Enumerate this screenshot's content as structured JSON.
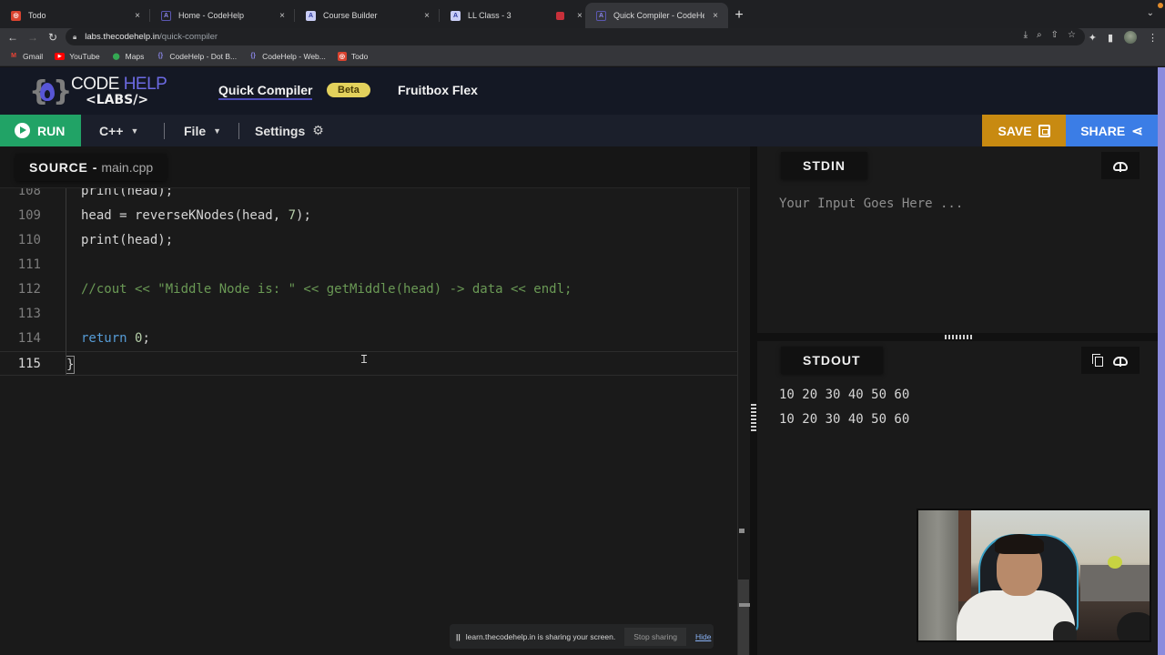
{
  "browser": {
    "tabs": [
      {
        "title": "Todo",
        "favicon": "todo-icon",
        "active": false
      },
      {
        "title": "Home - CodeHelp",
        "favicon": "codehelp-icon",
        "active": false
      },
      {
        "title": "Course Builder",
        "favicon": "course-builder-icon",
        "active": false
      },
      {
        "title": "LL Class - 3",
        "favicon": "course-builder-icon",
        "active": false
      },
      {
        "title": "",
        "favicon": "recording-icon",
        "active": false
      },
      {
        "title": "Quick Compiler - CodeHelp Labs",
        "favicon": "codehelp-icon",
        "active": true
      }
    ],
    "new_tab_label": "+",
    "close_label": "×",
    "url_host": "labs.thecodehelp.in",
    "url_path": "/quick-compiler",
    "bookmarks": [
      {
        "label": "Gmail",
        "icon": "gmail-icon",
        "glyph": "M"
      },
      {
        "label": "YouTube",
        "icon": "youtube-icon",
        "glyph": "▶"
      },
      {
        "label": "Maps",
        "icon": "maps-icon",
        "glyph": "⬤"
      },
      {
        "label": "CodeHelp - Dot B...",
        "icon": "codehelp-icon",
        "glyph": "{}"
      },
      {
        "label": "CodeHelp - Web...",
        "icon": "codehelp-icon",
        "glyph": "{}"
      },
      {
        "label": "Todo",
        "icon": "todo-icon",
        "glyph": "◎"
      }
    ]
  },
  "app": {
    "logo_line1_a": "CODE ",
    "logo_line1_b": "HELP",
    "logo_line2": "<LABS/>",
    "nav": {
      "quick_compiler": "Quick Compiler",
      "beta_badge": "Beta",
      "fruitbox_flex": "Fruitbox Flex"
    },
    "toolbar": {
      "run_label": "RUN",
      "language": "C++",
      "file_label": "File",
      "settings_label": "Settings",
      "save_label": "SAVE",
      "share_label": "SHARE"
    },
    "accent_colors": {
      "run": "#21a366",
      "save": "#c88a11",
      "share": "#3b7de6",
      "beta": "#e3d15c"
    }
  },
  "editor": {
    "tab_label": "SOURCE",
    "tab_separator": "-",
    "filename": "main.cpp",
    "lines": [
      {
        "n": "108",
        "segments": [
          {
            "t": "print(head);",
            "c": ""
          }
        ]
      },
      {
        "n": "109",
        "segments": [
          {
            "t": "head = reverseKNodes(head, ",
            "c": ""
          },
          {
            "t": "7",
            "c": "tok-num"
          },
          {
            "t": ");",
            "c": ""
          }
        ]
      },
      {
        "n": "110",
        "segments": [
          {
            "t": "print(head);",
            "c": ""
          }
        ]
      },
      {
        "n": "111",
        "segments": []
      },
      {
        "n": "112",
        "segments": [
          {
            "t": "//cout << \"Middle Node is: \" << getMiddle(head) -> data << endl;",
            "c": "tok-cmt"
          }
        ]
      },
      {
        "n": "113",
        "segments": []
      },
      {
        "n": "114",
        "segments": [
          {
            "t": "return",
            "c": "tok-kw"
          },
          {
            "t": " ",
            "c": ""
          },
          {
            "t": "0",
            "c": "tok-num"
          },
          {
            "t": ";",
            "c": ""
          }
        ]
      },
      {
        "n": "115",
        "segments": [],
        "closing_brace": "}",
        "active": true
      }
    ]
  },
  "stdin": {
    "title": "STDIN",
    "placeholder": "Your Input Goes Here ...",
    "value": ""
  },
  "stdout": {
    "title": "STDOUT",
    "lines": [
      "10 20 30 40 50 60",
      "10 20 30 40 50 60"
    ]
  },
  "screen_share": {
    "message": "learn.thecodehelp.in is sharing your screen.",
    "stop_label": "Stop sharing",
    "hide_label": "Hide"
  }
}
